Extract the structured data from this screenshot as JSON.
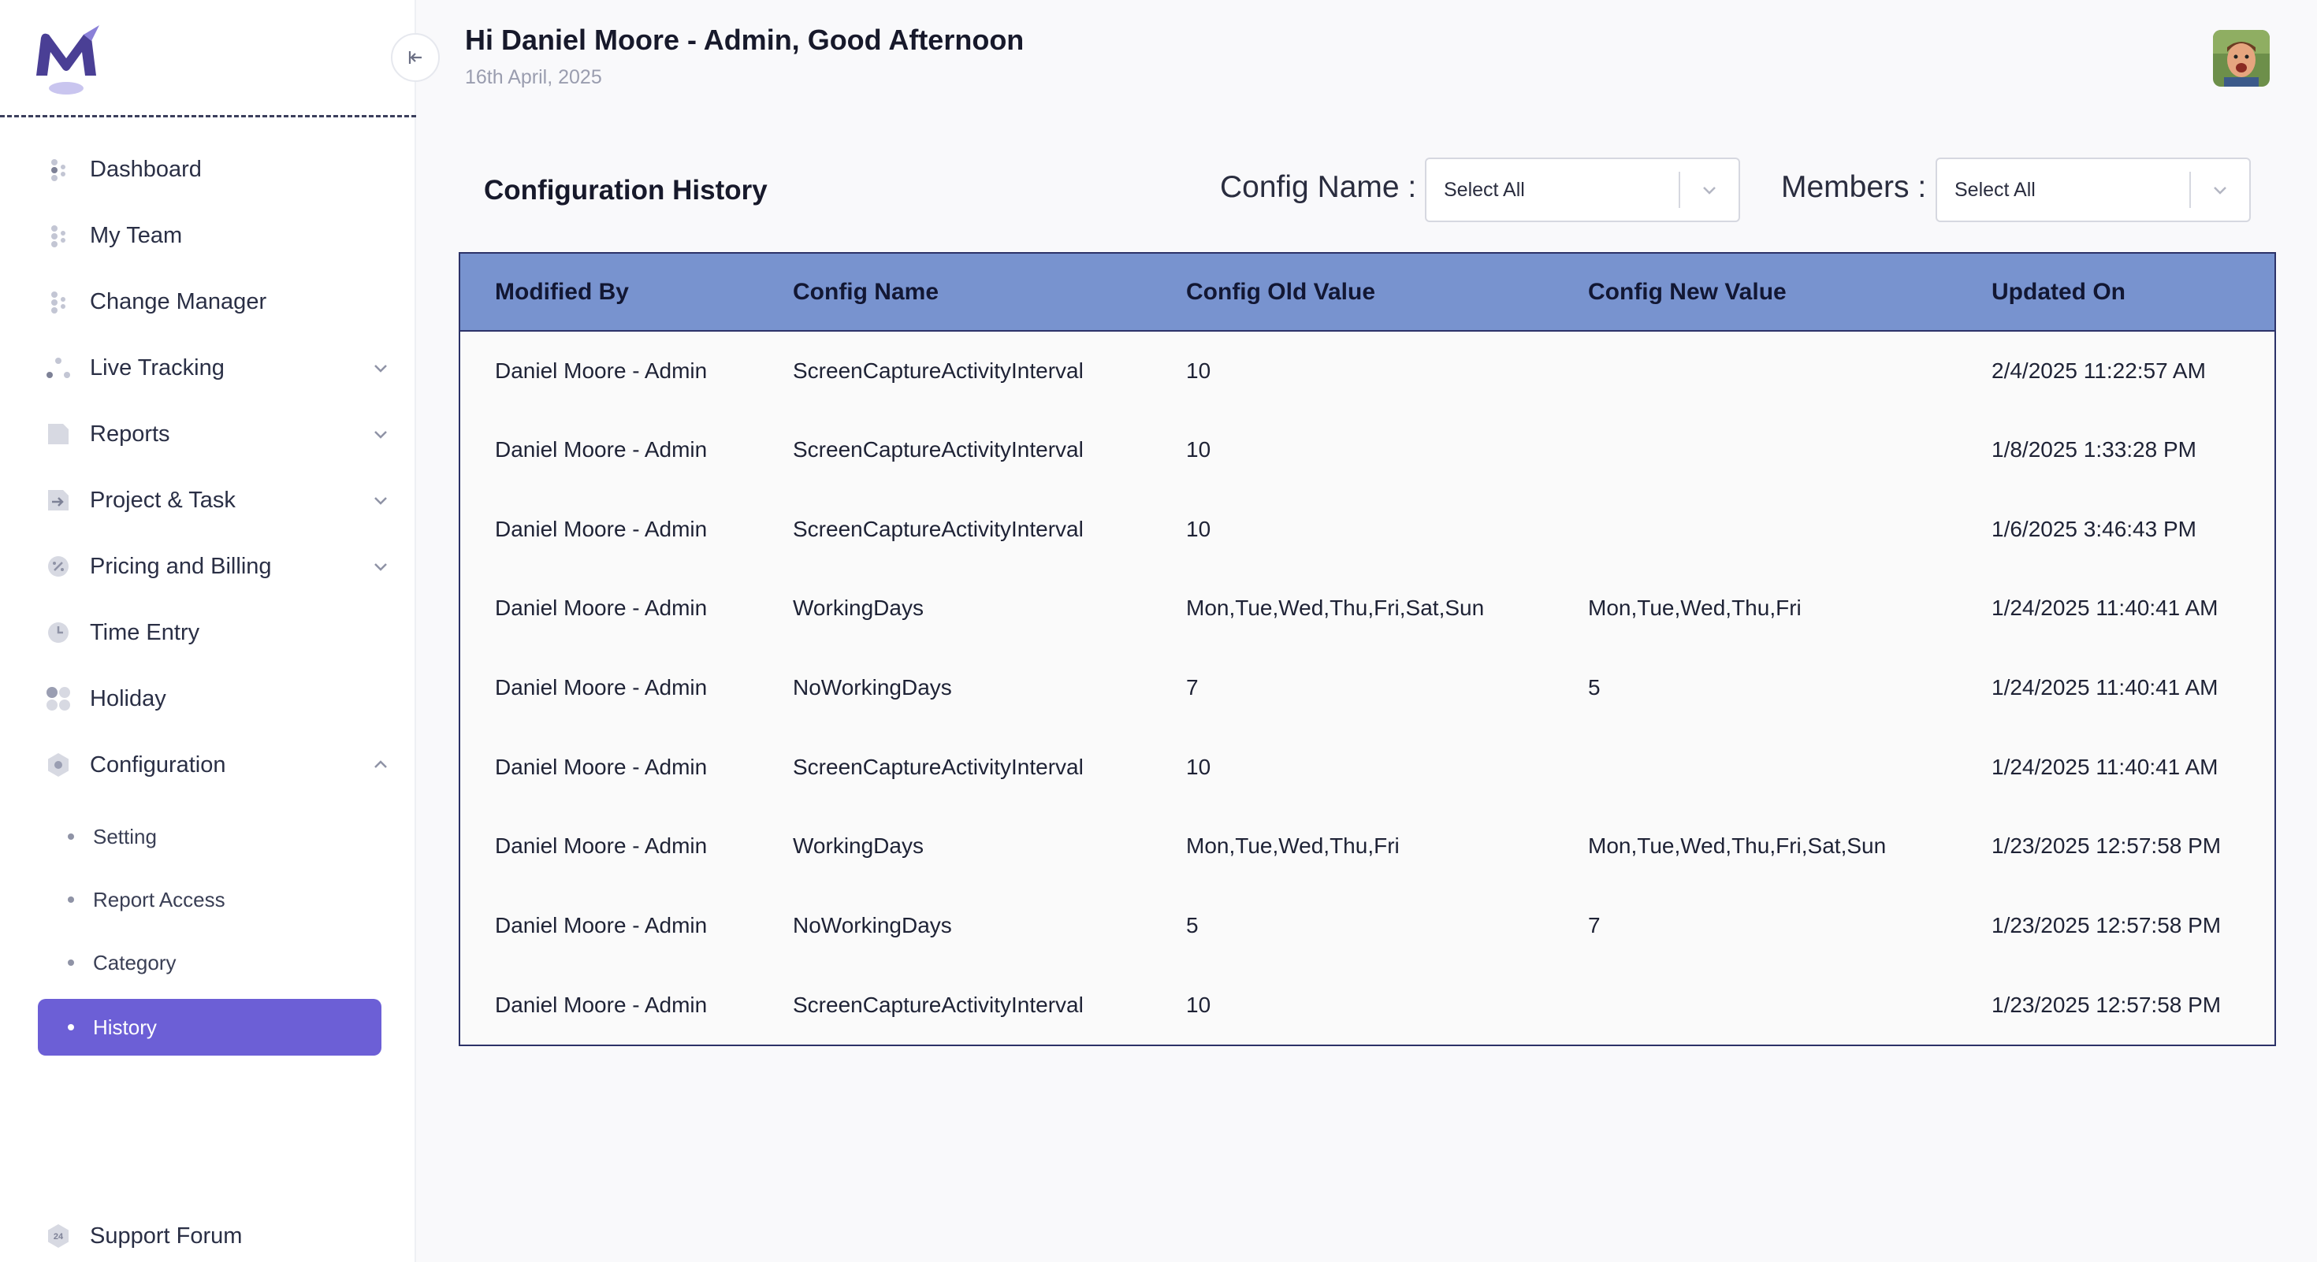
{
  "header": {
    "greeting": "Hi Daniel Moore - Admin, Good Afternoon",
    "date": "16th April, 2025"
  },
  "sidebar": {
    "items": [
      {
        "label": "Dashboard",
        "icon": "dashboard-icon"
      },
      {
        "label": "My Team",
        "icon": "team-icon"
      },
      {
        "label": "Change Manager",
        "icon": "change-manager-icon"
      },
      {
        "label": "Live Tracking",
        "icon": "live-tracking-icon",
        "expandable": true
      },
      {
        "label": "Reports",
        "icon": "reports-icon",
        "expandable": true
      },
      {
        "label": "Project & Task",
        "icon": "project-icon",
        "expandable": true
      },
      {
        "label": "Pricing and Billing",
        "icon": "billing-icon",
        "expandable": true
      },
      {
        "label": "Time Entry",
        "icon": "clock-icon"
      },
      {
        "label": "Holiday",
        "icon": "holiday-icon"
      },
      {
        "label": "Configuration",
        "icon": "gear-icon",
        "expanded": true
      }
    ],
    "sub_items": [
      {
        "label": "Setting"
      },
      {
        "label": "Report Access"
      },
      {
        "label": "Category"
      },
      {
        "label": "History",
        "active": true
      }
    ],
    "footer_item": {
      "label": "Support Forum",
      "icon": "support-24-icon",
      "badge": "24"
    }
  },
  "main": {
    "title": "Configuration History",
    "filters": {
      "config_name_label": "Config Name :",
      "config_name_value": "Select All",
      "members_label": "Members :",
      "members_value": "Select All"
    },
    "table": {
      "columns": [
        "Modified By",
        "Config Name",
        "Config Old Value",
        "Config New Value",
        "Updated On"
      ],
      "rows": [
        [
          "Daniel Moore - Admin",
          "ScreenCaptureActivityInterval",
          "10",
          "",
          "2/4/2025 11:22:57 AM"
        ],
        [
          "Daniel Moore - Admin",
          "ScreenCaptureActivityInterval",
          "10",
          "",
          "1/8/2025 1:33:28 PM"
        ],
        [
          "Daniel Moore - Admin",
          "ScreenCaptureActivityInterval",
          "10",
          "",
          "1/6/2025 3:46:43 PM"
        ],
        [
          "Daniel Moore - Admin",
          "WorkingDays",
          "Mon,Tue,Wed,Thu,Fri,Sat,Sun",
          "Mon,Tue,Wed,Thu,Fri",
          "1/24/2025 11:40:41 AM"
        ],
        [
          "Daniel Moore - Admin",
          "NoWorkingDays",
          "7",
          "5",
          "1/24/2025 11:40:41 AM"
        ],
        [
          "Daniel Moore - Admin",
          "ScreenCaptureActivityInterval",
          "10",
          "",
          "1/24/2025 11:40:41 AM"
        ],
        [
          "Daniel Moore - Admin",
          "WorkingDays",
          "Mon,Tue,Wed,Thu,Fri",
          "Mon,Tue,Wed,Thu,Fri,Sat,Sun",
          "1/23/2025 12:57:58 PM"
        ],
        [
          "Daniel Moore - Admin",
          "NoWorkingDays",
          "5",
          "7",
          "1/23/2025 12:57:58 PM"
        ],
        [
          "Daniel Moore - Admin",
          "ScreenCaptureActivityInterval",
          "10",
          "",
          "1/23/2025 12:57:58 PM"
        ]
      ]
    }
  },
  "colors": {
    "accent": "#6c5fd6",
    "table_header": "#7893cf",
    "table_border": "#2c3268",
    "logo_primary": "#4a3f95",
    "logo_secondary": "#b9b4ec"
  }
}
